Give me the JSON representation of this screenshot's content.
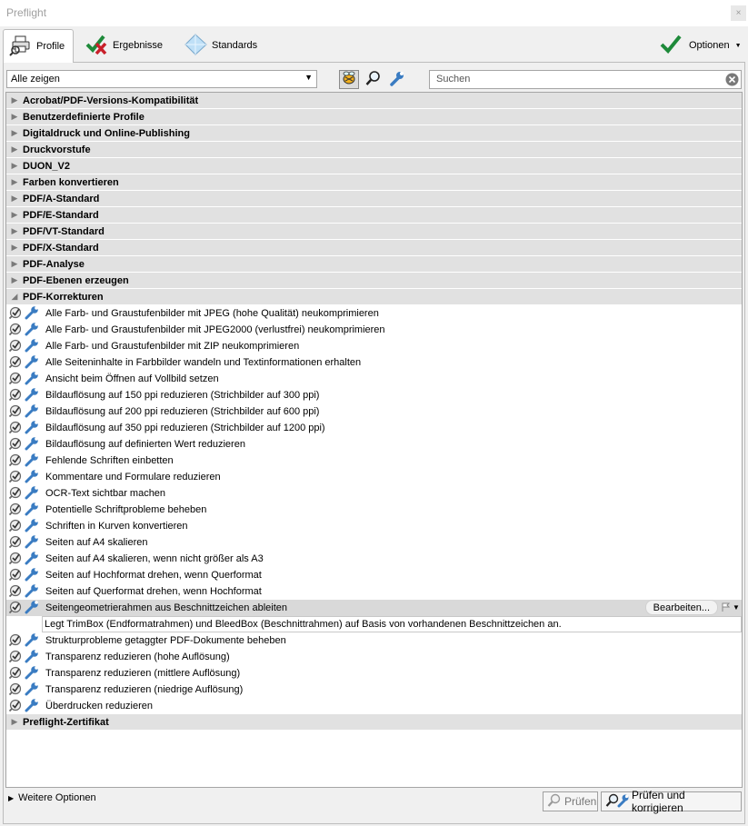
{
  "window": {
    "title": "Preflight",
    "close_glyph": "×"
  },
  "tabs": [
    {
      "label": "Profile",
      "icon": "profile-printer-icon"
    },
    {
      "label": "Ergebnisse",
      "icon": "check-cross-icon"
    },
    {
      "label": "Standards",
      "icon": "diamond-icon"
    }
  ],
  "options": {
    "label": "Optionen",
    "icon": "green-check-icon"
  },
  "filter": {
    "selected": "Alle zeigen"
  },
  "search": {
    "placeholder": "Suchen"
  },
  "groups_before": [
    "Acrobat/PDF-Versions-Kompatibilität",
    "Benutzerdefinierte Profile",
    "Digitaldruck und Online-Publishing",
    "Druckvorstufe",
    "DUON_V2",
    "Farben konvertieren",
    "PDF/A-Standard",
    "PDF/E-Standard",
    "PDF/VT-Standard",
    "PDF/X-Standard",
    "PDF-Analyse",
    "PDF-Ebenen erzeugen"
  ],
  "open_group": "PDF-Korrekturen",
  "items_a": [
    "Alle Farb- und Graustufenbilder mit JPEG (hohe Qualität) neukomprimieren",
    "Alle Farb- und Graustufenbilder mit JPEG2000 (verlustfrei) neukomprimieren",
    "Alle Farb- und Graustufenbilder mit ZIP neukomprimieren",
    "Alle Seiteninhalte in Farbbilder wandeln und Textinformationen erhalten",
    "Ansicht beim Öffnen auf Vollbild setzen",
    "Bildauflösung auf 150 ppi reduzieren (Strichbilder auf 300 ppi)",
    "Bildauflösung auf 200 ppi reduzieren (Strichbilder auf 600 ppi)",
    "Bildauflösung auf 350 ppi reduzieren (Strichbilder auf 1200 ppi)",
    "Bildauflösung auf definierten Wert reduzieren",
    "Fehlende Schriften einbetten",
    "Kommentare und Formulare reduzieren",
    "OCR-Text sichtbar machen",
    "Potentielle Schriftprobleme beheben",
    "Schriften in Kurven konvertieren",
    "Seiten auf A4 skalieren",
    "Seiten auf A4 skalieren, wenn nicht größer als A3",
    "Seiten auf Hochformat drehen, wenn Querformat",
    "Seiten auf Querformat drehen, wenn Hochformat"
  ],
  "selected_item": {
    "label": "Seitengeometrierahmen aus Beschnittzeichen ableiten",
    "edit_label": "Bearbeiten...",
    "description": "Legt TrimBox (Endformatrahmen) und BleedBox (Beschnittrahmen) auf Basis von vorhandenen Beschnittzeichen an."
  },
  "items_b": [
    "Strukturprobleme getaggter PDF-Dokumente beheben",
    "Transparenz reduzieren (hohe Auflösung)",
    "Transparenz reduzieren (mittlere Auflösung)",
    "Transparenz reduzieren (niedrige Auflösung)",
    "Überdrucken reduzieren"
  ],
  "groups_after": [
    "Preflight-Zertifikat"
  ],
  "footer": {
    "more_options": "Weitere Optionen",
    "check_label": "Prüfen",
    "fix_label": "Prüfen und korrigieren"
  }
}
